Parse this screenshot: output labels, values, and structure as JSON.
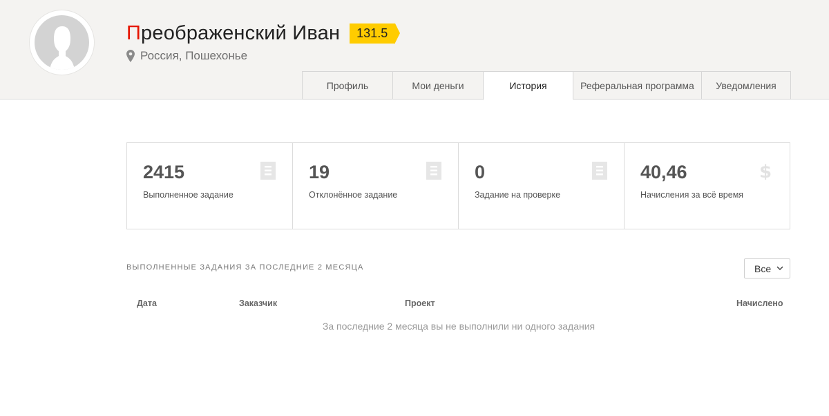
{
  "profile": {
    "name_first_letter": "П",
    "name_rest": "реображенский Иван",
    "rating": "131.5",
    "location": "Россия, Пошехонье",
    "avatar_icon": "user-silhouette-icon",
    "location_icon": "map-pin-icon"
  },
  "tabs": [
    {
      "label": "Профиль"
    },
    {
      "label": "Мои деньги"
    },
    {
      "label": "История"
    },
    {
      "label": "Реферальная программа"
    },
    {
      "label": "Уведомления"
    }
  ],
  "stats": [
    {
      "value": "2415",
      "label": "Выполненное задание",
      "icon": "document-icon"
    },
    {
      "value": "19",
      "label": "Отклонённое задание",
      "icon": "document-icon"
    },
    {
      "value": "0",
      "label": "Задание на проверке",
      "icon": "document-icon"
    },
    {
      "value": "40,46",
      "label": "Начисления за всё время",
      "icon": "dollar-icon"
    }
  ],
  "history": {
    "title": "Выполненные задания за последние 2 месяца",
    "filter_value": "Все",
    "columns": {
      "date": "Дата",
      "customer": "Заказчик",
      "project": "Проект",
      "accrued": "Начислено"
    },
    "empty_message": "За последние 2 месяца вы не выполнили ни одного задания"
  },
  "colors": {
    "brand_red": "#e61400",
    "rating_yellow": "#ffcc00",
    "header_bg": "#f4f3f1"
  }
}
